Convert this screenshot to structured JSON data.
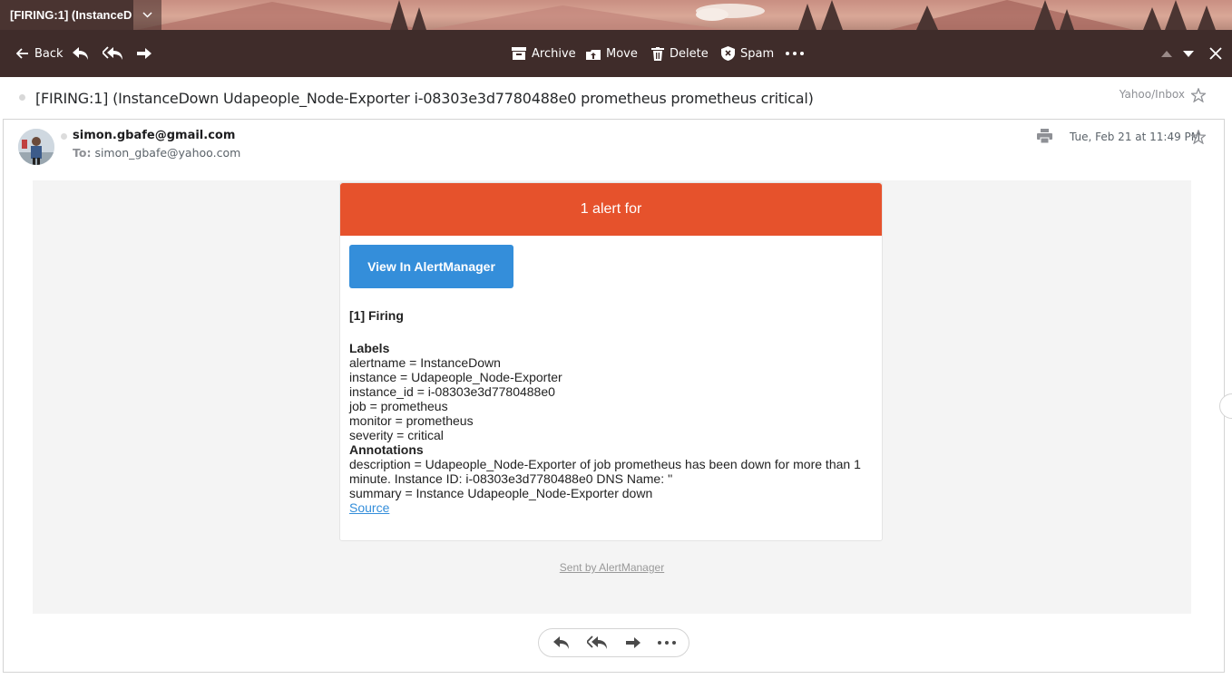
{
  "tab": {
    "title": "[FIRING:1] (InstanceD"
  },
  "toolbar": {
    "back_label": "Back",
    "archive_label": "Archive",
    "move_label": "Move",
    "delete_label": "Delete",
    "spam_label": "Spam"
  },
  "message": {
    "subject": "[FIRING:1] (InstanceDown Udapeople_Node-Exporter i-08303e3d7780488e0 prometheus prometheus critical)",
    "folder": "Yahoo/Inbox",
    "sender": "simon.gbafe@gmail.com",
    "to_label": "To:",
    "to_address": "simon_gbafe@yahoo.com",
    "date": "Tue, Feb 21 at 11:49 PM"
  },
  "alert": {
    "header": "1 alert for",
    "button_label": "View In AlertManager",
    "firing_heading": "[1] Firing",
    "labels_heading": "Labels",
    "labels": [
      "alertname = InstanceDown",
      "instance = Udapeople_Node-Exporter",
      "instance_id = i-08303e3d7780488e0",
      "job = prometheus",
      "monitor = prometheus",
      "severity = critical"
    ],
    "annotations_heading": "Annotations",
    "annotations": [
      "description = Udapeople_Node-Exporter of job prometheus has been down for more than 1 minute. Instance ID: i-08303e3d7780488e0 DNS Name: ''",
      "summary = Instance Udapeople_Node-Exporter down"
    ],
    "source_label": "Source",
    "footer": "Sent by AlertManager"
  },
  "colors": {
    "toolbar_bg": "#3f2c2a",
    "alert_header": "#e6522c",
    "button_blue": "#348eda",
    "body_bg": "#f4f4f4"
  },
  "icons": [
    "back-arrow-icon",
    "reply-icon",
    "reply-all-icon",
    "forward-icon",
    "archive-icon",
    "move-icon",
    "trash-icon",
    "spam-shield-icon",
    "more-icon",
    "up-arrow-icon",
    "down-arrow-icon",
    "close-icon",
    "star-icon",
    "print-icon",
    "chevron-down-icon"
  ]
}
